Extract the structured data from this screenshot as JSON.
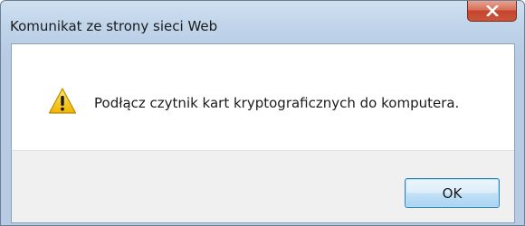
{
  "window": {
    "title": "Komunikat ze strony sieci Web"
  },
  "dialog": {
    "icon": "warning-icon",
    "message": "Podłącz czytnik kart kryptograficznych do komputera.",
    "ok_label": "OK"
  },
  "colors": {
    "close_button": "#c7442d",
    "ok_border": "#3c7fb1",
    "warning_yellow": "#f5c400"
  }
}
